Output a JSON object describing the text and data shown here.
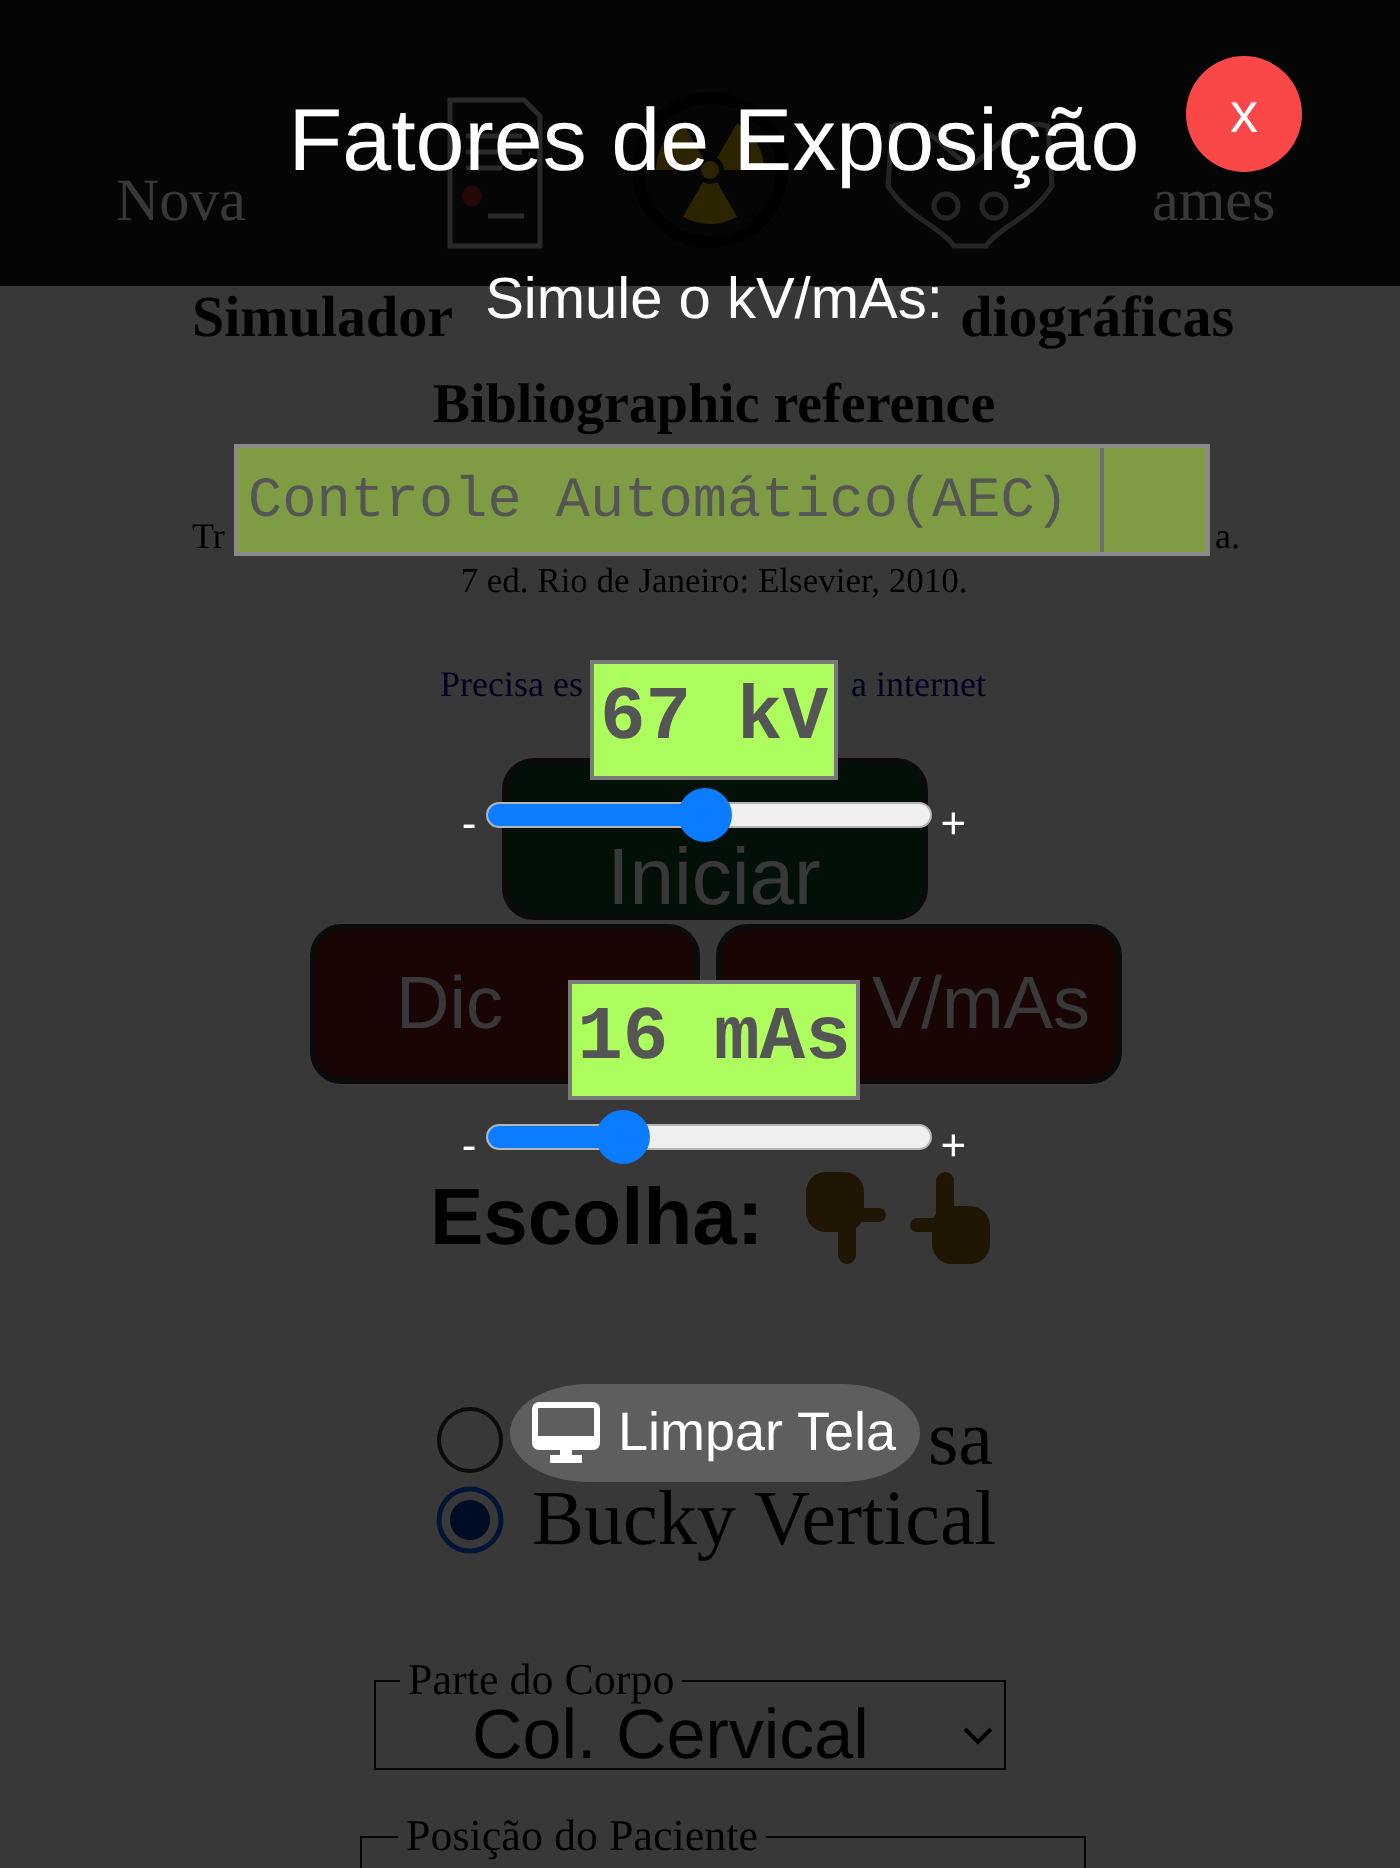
{
  "page": {
    "nav": {
      "left_label": "Nova",
      "right_label": "ames"
    },
    "heading_fragments": [
      "Simulador",
      "diográficas"
    ],
    "reference": {
      "title": "Bibliographic reference",
      "line_1_fragments": [
        "Tr",
        "a."
      ],
      "line_2": "7 ed. Rio de Janeiro: Elsevier, 2010.",
      "note_fragments": [
        "Precisa es",
        "a internet"
      ]
    },
    "buttons": [
      {
        "kind": "start",
        "label": "Iniciar"
      },
      {
        "kind": "tips",
        "label": "Dic"
      },
      {
        "kind": "exposure",
        "label": "V/mAs"
      }
    ],
    "choose_label": "Escolha:",
    "receptor_options": [
      {
        "label": "sa",
        "selected": false
      },
      {
        "label": "Bucky Vertical",
        "selected": true
      }
    ],
    "fields": [
      {
        "legend": "Parte do Corpo",
        "value": "Col. Cervical"
      },
      {
        "legend": "Posição do Paciente"
      }
    ]
  },
  "modal": {
    "title": "Fatores de Exposição",
    "close_label": "x",
    "subtitle": "Simule o kV/mAs:",
    "mode_select": {
      "value": "Controle Automático(AEC)"
    },
    "controls": [
      {
        "reading": "67 kV",
        "minus_label": "-",
        "plus_label": "+",
        "level": 0.49
      },
      {
        "reading": "16 mAs",
        "minus_label": "-",
        "plus_label": "+",
        "level": 0.28
      }
    ],
    "clear_button": {
      "label": "Limpar Tela"
    }
  }
}
